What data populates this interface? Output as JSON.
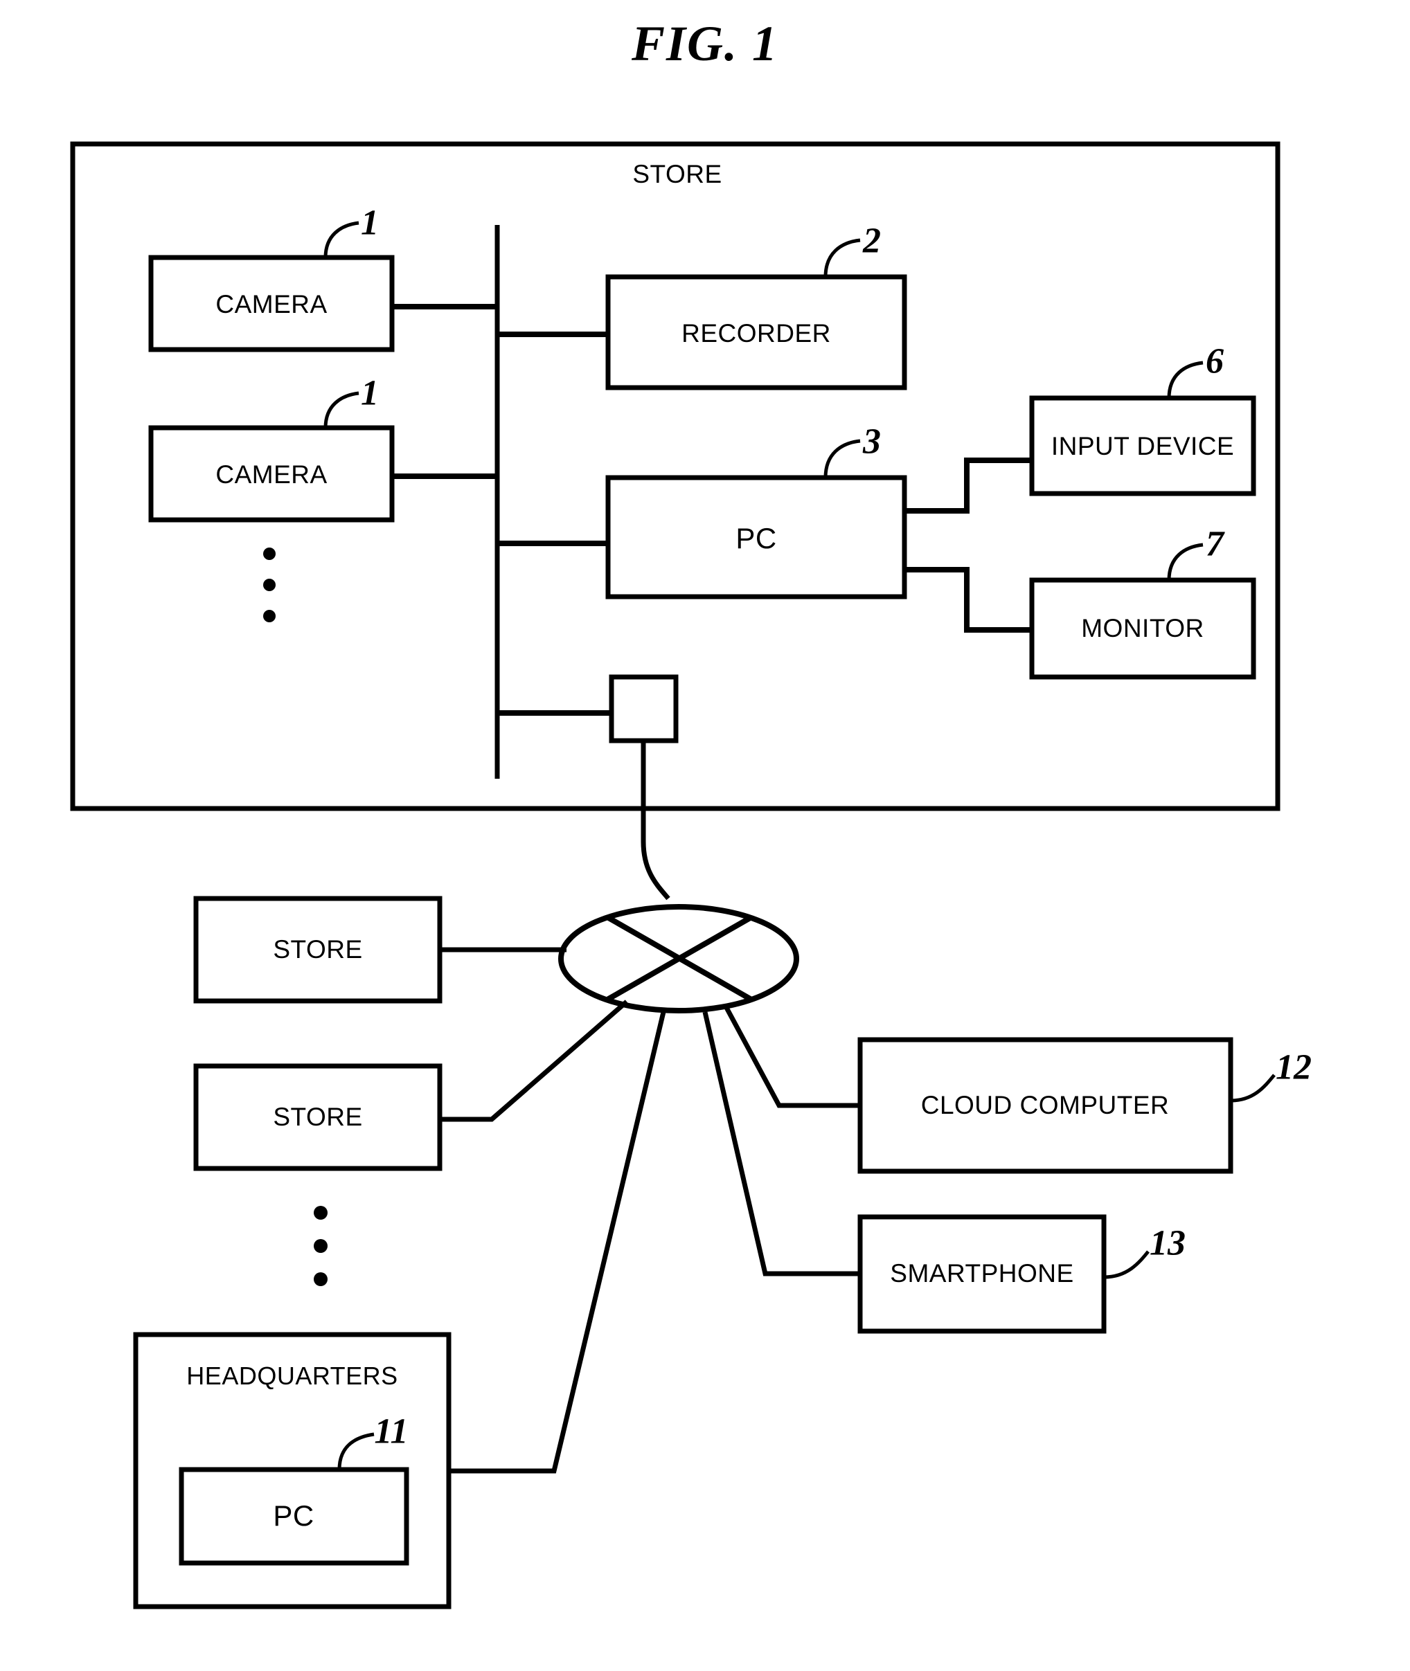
{
  "figure": {
    "title": "FIG. 1",
    "domain_note": "patent block diagram"
  },
  "store_enclosure": {
    "label": "STORE"
  },
  "blocks": {
    "camera_1": "CAMERA",
    "camera_2": "CAMERA",
    "recorder": "RECORDER",
    "pc_store": "PC",
    "input_device": "INPUT DEVICE",
    "monitor": "MONITOR",
    "network_interface": "",
    "store_remote_1": "STORE",
    "store_remote_2": "STORE",
    "cloud_computer": "CLOUD COMPUTER",
    "smartphone": "SMARTPHONE",
    "headquarters": "HEADQUARTERS",
    "pc_headquarters": "PC"
  },
  "reference_numerals": {
    "camera_1": "1",
    "camera_2": "1",
    "recorder": "2",
    "pc_store": "3",
    "input_device": "6",
    "monitor": "7",
    "pc_headquarters": "11",
    "cloud_computer": "12",
    "smartphone": "13"
  },
  "ellipsis": {
    "cameras": "⋮",
    "stores": "⋮"
  },
  "colors": {
    "line": "#000000",
    "background": "#ffffff"
  }
}
